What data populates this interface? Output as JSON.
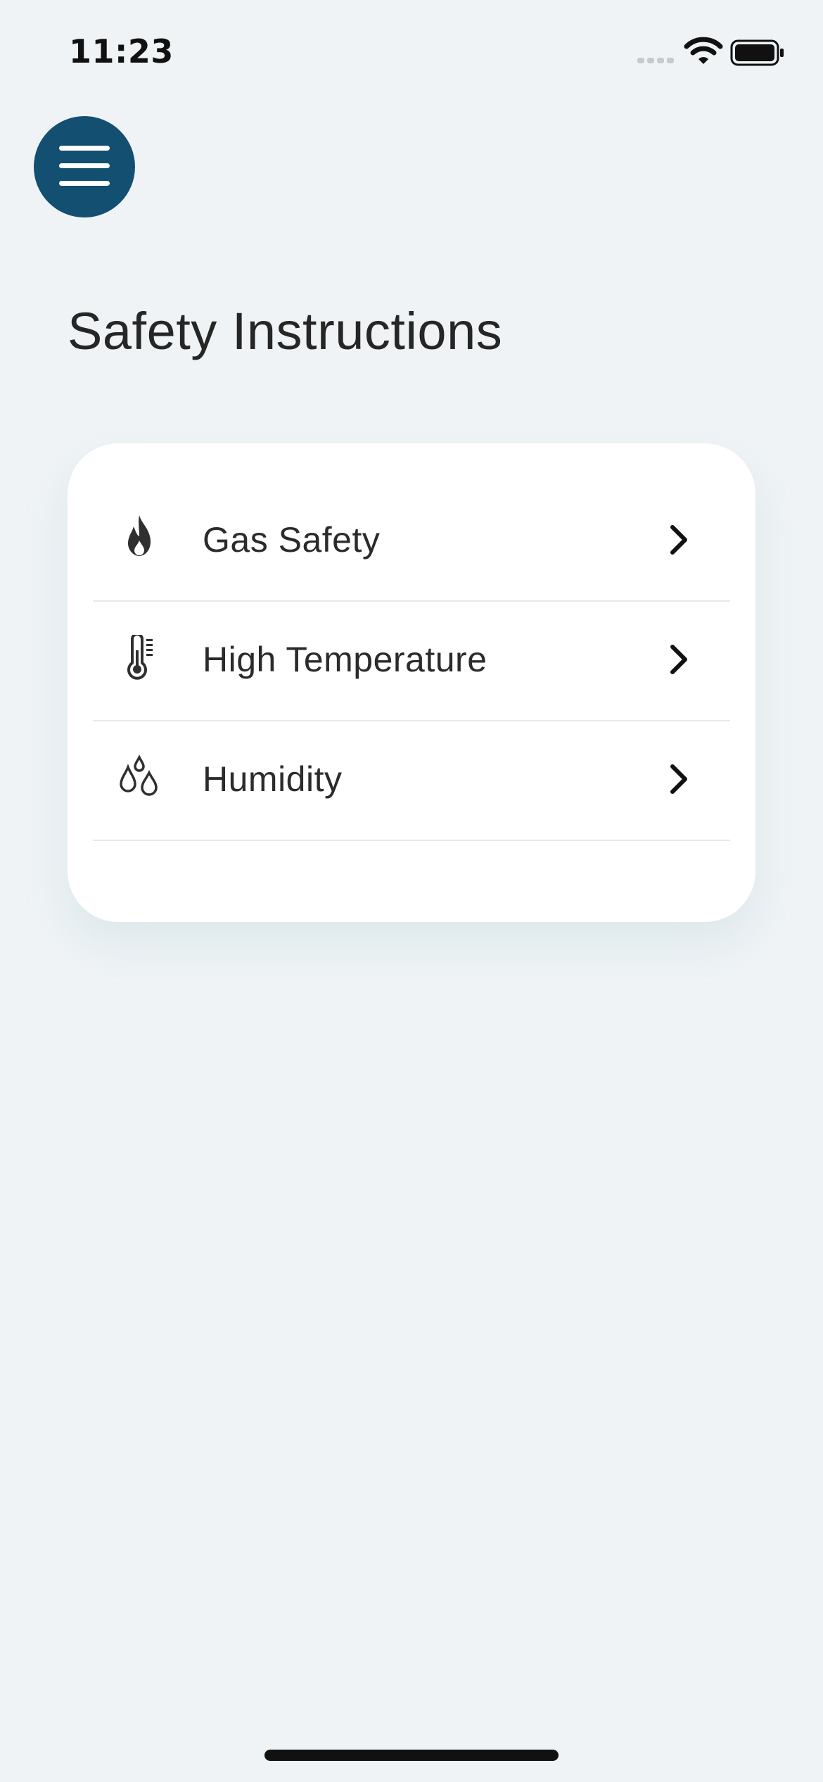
{
  "status_bar": {
    "time": "11:23"
  },
  "header": {
    "menu_icon": "hamburger-menu-icon"
  },
  "page": {
    "title": "Safety Instructions"
  },
  "instructions": [
    {
      "label": "Gas Safety",
      "icon": "flame-icon"
    },
    {
      "label": "High Temperature",
      "icon": "thermometer-icon"
    },
    {
      "label": "Humidity",
      "icon": "water-drops-icon"
    }
  ],
  "colors": {
    "background": "#eff3f5",
    "menu_button": "#134f70",
    "card": "#ffffff",
    "text": "#2b2b2b"
  }
}
